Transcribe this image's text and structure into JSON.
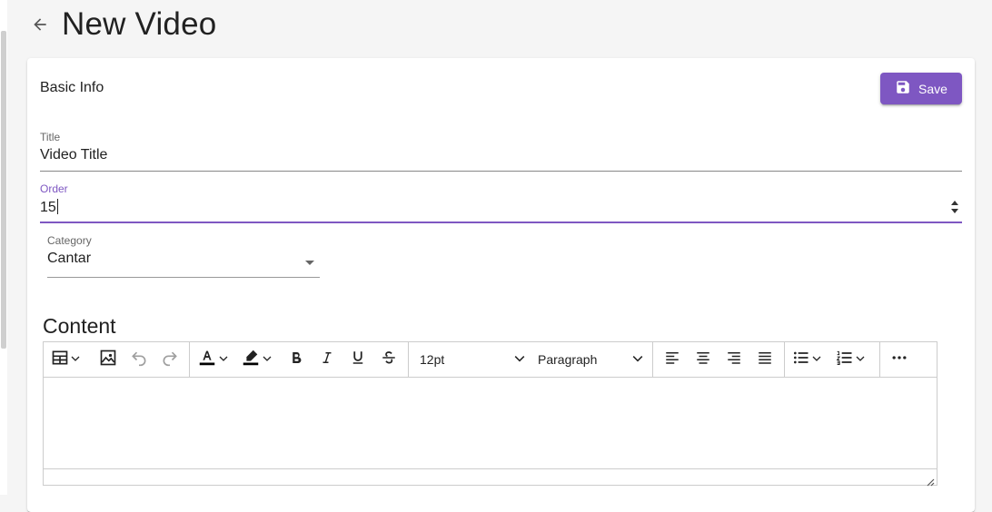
{
  "page": {
    "title": "New Video"
  },
  "card": {
    "section_title": "Basic Info",
    "save_label": "Save"
  },
  "form": {
    "title": {
      "label": "Title",
      "value": "Video Title"
    },
    "order": {
      "label": "Order",
      "value": "15"
    },
    "category": {
      "label": "Category",
      "value": "Cantar"
    }
  },
  "content": {
    "label": "Content",
    "toolbar": {
      "font_size": "12pt",
      "block_format": "Paragraph"
    }
  },
  "colors": {
    "accent": "#7e57c2"
  }
}
